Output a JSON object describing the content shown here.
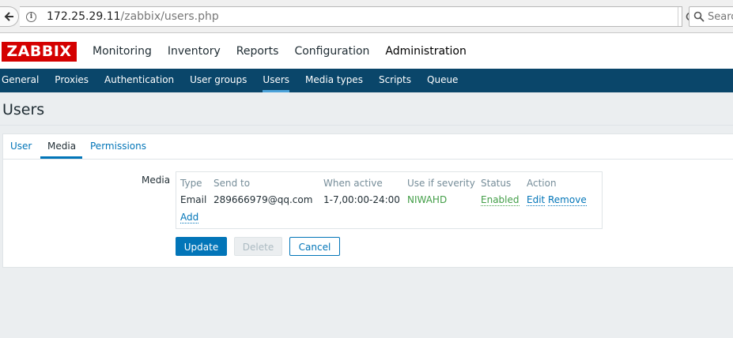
{
  "browser": {
    "url_host": "172.25.29.11",
    "url_path": "/zabbix/users.php",
    "search_placeholder": "Search"
  },
  "header": {
    "logo": "ZABBIX",
    "menu": [
      {
        "label": "Monitoring"
      },
      {
        "label": "Inventory"
      },
      {
        "label": "Reports"
      },
      {
        "label": "Configuration"
      },
      {
        "label": "Administration"
      }
    ],
    "active_menu": "Administration"
  },
  "subnav": {
    "items": [
      {
        "label": "General"
      },
      {
        "label": "Proxies"
      },
      {
        "label": "Authentication"
      },
      {
        "label": "User groups"
      },
      {
        "label": "Users"
      },
      {
        "label": "Media types"
      },
      {
        "label": "Scripts"
      },
      {
        "label": "Queue"
      }
    ],
    "active": "Users"
  },
  "page": {
    "title": "Users"
  },
  "tabs": {
    "items": [
      {
        "label": "User"
      },
      {
        "label": "Media"
      },
      {
        "label": "Permissions"
      }
    ],
    "active": "Media"
  },
  "media": {
    "label": "Media",
    "columns": [
      "Type",
      "Send to",
      "When active",
      "Use if severity",
      "Status",
      "Action"
    ],
    "rows": [
      {
        "type": "Email",
        "send_to": "289666979@qq.com",
        "when_active": "1-7,00:00-24:00",
        "severity": "NIWAHD",
        "status": "Enabled",
        "edit": "Edit",
        "remove": "Remove"
      }
    ],
    "add_label": "Add"
  },
  "buttons": {
    "update": "Update",
    "delete": "Delete",
    "cancel": "Cancel"
  },
  "colors": {
    "subnav_bg": "#0a466a",
    "logo_bg": "#d40000",
    "link": "#0275b8",
    "enabled": "#429e47"
  }
}
